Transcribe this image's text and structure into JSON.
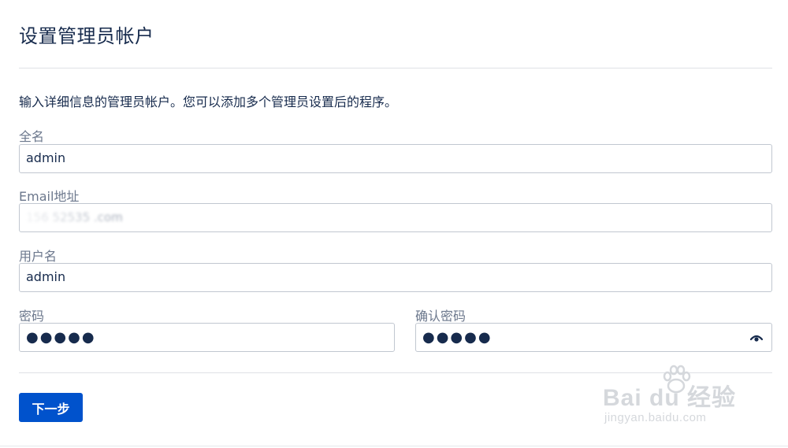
{
  "page": {
    "title": "设置管理员帐户",
    "intro": "输入详细信息的管理员帐户。您可以添加多个管理员设置后的程序。"
  },
  "form": {
    "full_name": {
      "label": "全名",
      "value": "admin"
    },
    "email": {
      "label": "Email地址",
      "value": "156  52535  .com"
    },
    "username": {
      "label": "用户名",
      "value": "admin"
    },
    "password": {
      "label": "密码",
      "value": "●●●●●"
    },
    "confirm_password": {
      "label": "确认密码",
      "value": "●●●●●"
    }
  },
  "actions": {
    "next_label": "下一步"
  },
  "watermark": {
    "brand": "Bai du 经验",
    "url": "jingyan.baidu.com"
  },
  "colors": {
    "primary_button": "#0052cc",
    "label": "#6b778c",
    "text": "#172b4d",
    "border": "#c1c7d0"
  },
  "icons": {
    "reveal_password": "eye-icon",
    "watermark_logo": "paw-icon"
  }
}
